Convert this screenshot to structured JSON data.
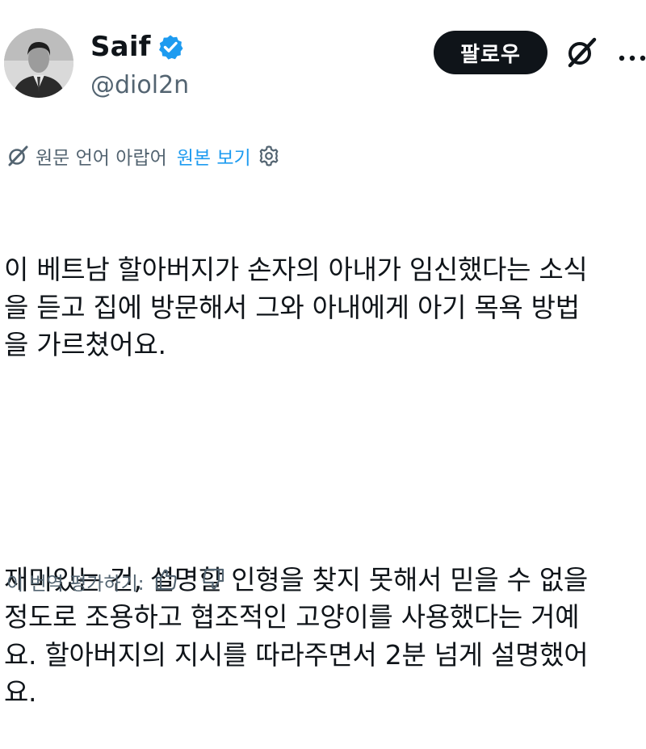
{
  "author": {
    "display_name": "Saif",
    "handle": "@diol2n",
    "verified": true,
    "verified_color": "#1d9bf0"
  },
  "header": {
    "follow_label": "팔로우",
    "grok_icon": "grok-icon",
    "more_icon": "more-icon"
  },
  "translation_bar": {
    "source_language": "원문 언어 아랍어",
    "show_original_label": "원본 보기",
    "settings_icon": "gear-icon",
    "accent_color": "#1d9bf0"
  },
  "tweet": {
    "paragraph_1": "이 베트남 할아버지가 손자의 아내가 임신했다는 소식\n을 듣고 집에 방문해서 그와 아내에게 아기 목욕 방법\n을 가르쳤어요.",
    "paragraph_2": "재미있는 건, 설명할 인형을 찾지 못해서 믿을 수 없을\n정도로 조용하고 협조적인 고양이를 사용했다는 거예\n요. 할아버지의 지시를 따라주면서 2분 넘게 설명했어\n요."
  },
  "rating": {
    "label": "이 번역 평가하기:",
    "thumbs_up_icon": "thumbs-up-icon",
    "thumbs_down_icon": "thumbs-down-icon"
  }
}
